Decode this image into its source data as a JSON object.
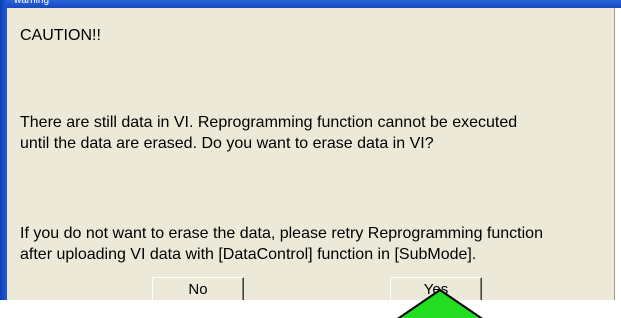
{
  "window": {
    "title": "warning"
  },
  "dialog": {
    "caution": "CAUTION!!",
    "message_lines": [
      "There are still data in VI. Reprogramming function cannot be executed",
      "until the data are erased. Do you want to erase data in VI?",
      "If you do not want to erase the data, please retry Reprogramming function",
      "after uploading VI data with [DataControl] function in [SubMode]."
    ]
  },
  "buttons": {
    "no_label": "No",
    "yes_label": "Yes"
  },
  "colors": {
    "dialog_background": "#ece9d8",
    "title_bar": "#1f5ad6",
    "pointer_arrow": "#22dd22"
  },
  "icons": {
    "pointer": "green-up-arrow-icon"
  }
}
